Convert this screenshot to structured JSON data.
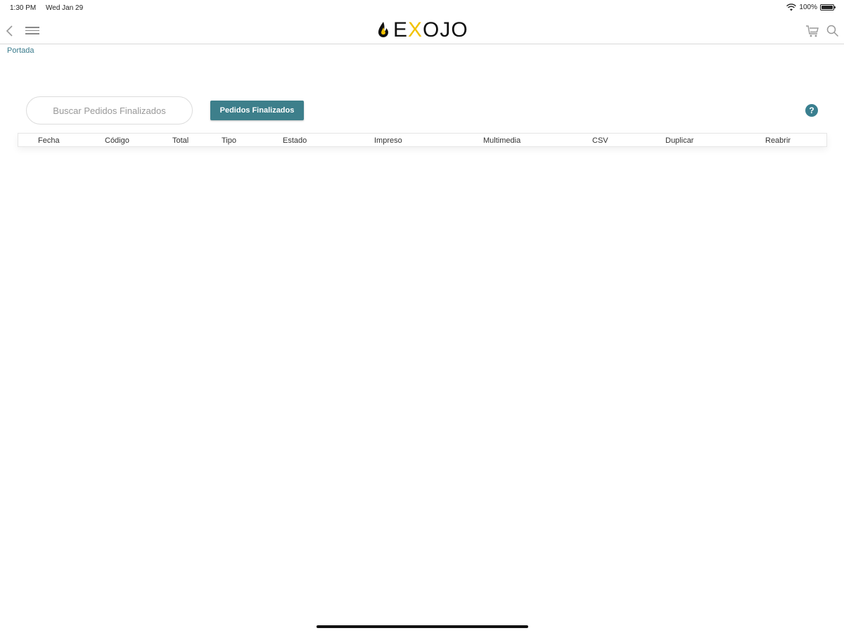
{
  "status_bar": {
    "time": "1:30 PM",
    "date": "Wed Jan 29",
    "battery": "100%",
    "icons": [
      "wifi-icon",
      "battery-icon"
    ]
  },
  "nav": {
    "logo_prefix": "E",
    "logo_x": "X",
    "logo_suffix": "OJO",
    "icons": [
      "back-chevron-icon",
      "hamburger-menu-icon",
      "cart-icon",
      "search-icon"
    ]
  },
  "breadcrumb": {
    "home": "Portada"
  },
  "search": {
    "placeholder": "Buscar Pedidos Finalizados"
  },
  "button": {
    "finished_orders": "Pedidos Finalizados"
  },
  "help": {
    "label": "?"
  },
  "table": {
    "columns": [
      "Fecha",
      "Código",
      "Total",
      "Tipo",
      "Estado",
      "Impreso",
      "Multimedia",
      "CSV",
      "Duplicar",
      "Reabrir"
    ],
    "rows": []
  },
  "colors": {
    "accent": "#3d7f8b",
    "logo_yellow": "#f2c200",
    "link": "#3a7b8c"
  }
}
